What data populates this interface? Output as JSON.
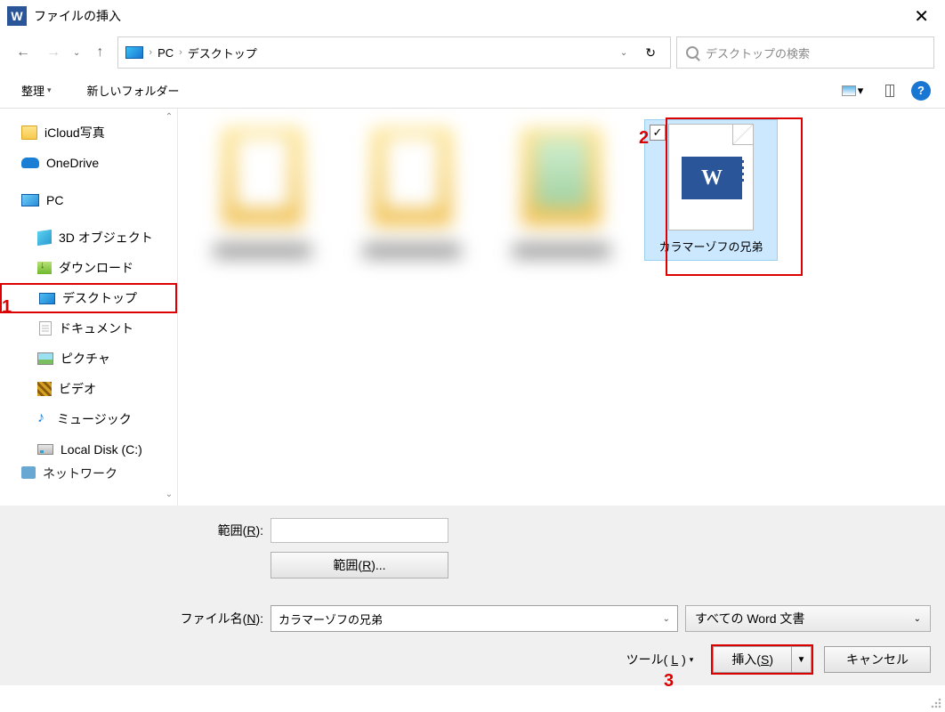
{
  "titlebar": {
    "title": "ファイルの挿入"
  },
  "nav": {
    "path_root": "PC",
    "path_current": "デスクトップ",
    "search_placeholder": "デスクトップの検索"
  },
  "toolbar": {
    "organize": "整理",
    "new_folder": "新しいフォルダー"
  },
  "tree": {
    "items": [
      {
        "label": "iCloud写真",
        "icon": "folder",
        "child": false
      },
      {
        "label": "OneDrive",
        "icon": "cloud",
        "child": false
      },
      {
        "label": "PC",
        "icon": "pc",
        "child": false
      },
      {
        "label": "3D オブジェクト",
        "icon": "3d",
        "child": true
      },
      {
        "label": "ダウンロード",
        "icon": "dl",
        "child": true
      },
      {
        "label": "デスクトップ",
        "icon": "desk",
        "child": true,
        "selected": true,
        "annot": true
      },
      {
        "label": "ドキュメント",
        "icon": "doc",
        "child": true
      },
      {
        "label": "ピクチャ",
        "icon": "pic",
        "child": true
      },
      {
        "label": "ビデオ",
        "icon": "vid",
        "child": true
      },
      {
        "label": "ミュージック",
        "icon": "mus",
        "child": true
      },
      {
        "label": "Local Disk (C:)",
        "icon": "disk",
        "child": true
      },
      {
        "label": "ネットワーク",
        "icon": "net",
        "child": false,
        "cut": true
      }
    ]
  },
  "content": {
    "selected_file": {
      "label": "カラマーゾフの兄弟"
    }
  },
  "bottom": {
    "range_label": "範囲(",
    "range_key": "R",
    "range_suffix": "):",
    "range_btn": "範囲(",
    "range_btn_key": "R",
    "range_btn_suffix": ")...",
    "filename_label": "ファイル名(",
    "filename_key": "N",
    "filename_suffix": "):",
    "filename_value": "カラマーゾフの兄弟",
    "filetype": "すべての Word 文書",
    "tool": "ツール(",
    "tool_key": "L",
    "tool_suffix": ")",
    "insert": "挿入(",
    "insert_key": "S",
    "insert_suffix": ")",
    "cancel": "キャンセル"
  },
  "annotations": {
    "one": "1",
    "two": "2",
    "three": "3"
  }
}
